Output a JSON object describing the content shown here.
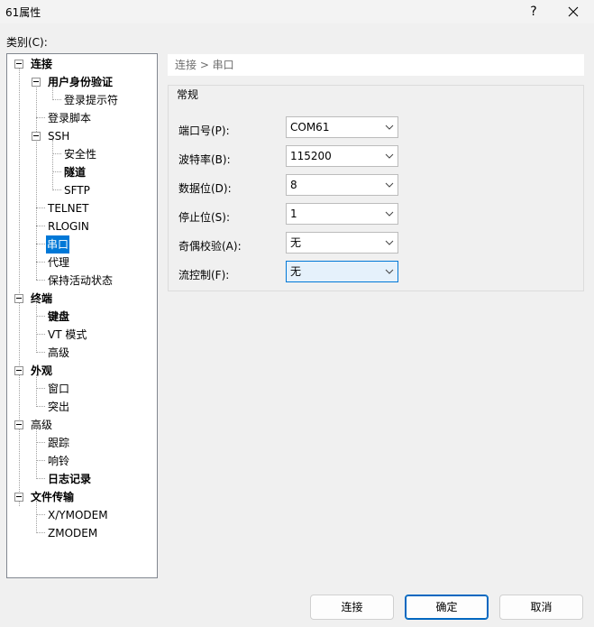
{
  "window": {
    "title": "61属性",
    "help_glyph": "?"
  },
  "category_label": "类别(C):",
  "tree": {
    "connection": "连接",
    "auth": "用户身份验证",
    "login_prompt": "登录提示符",
    "login_script": "登录脚本",
    "ssh": "SSH",
    "security": "安全性",
    "tunnel": "隧道",
    "sftp": "SFTP",
    "telnet": "TELNET",
    "rlogin": "RLOGIN",
    "serial": "串口",
    "proxy": "代理",
    "keepalive": "保持活动状态",
    "terminal": "终端",
    "keyboard": "键盘",
    "vt_mode": "VT 模式",
    "terminal_advanced": "高级",
    "appearance": "外观",
    "window": "窗口",
    "highlight": "突出",
    "advanced": "高级",
    "trace": "跟踪",
    "bell": "响铃",
    "logging": "日志记录",
    "file_transfer": "文件传输",
    "xymodem": "X/YMODEM",
    "zmodem": "ZMODEM"
  },
  "breadcrumb": "连接 > 串口",
  "group_title": "常规",
  "fields": {
    "port": {
      "label": "端口号(P):",
      "value": "COM61"
    },
    "baud": {
      "label": "波特率(B):",
      "value": "115200"
    },
    "data_bits": {
      "label": "数据位(D):",
      "value": "8"
    },
    "stop_bits": {
      "label": "停止位(S):",
      "value": "1"
    },
    "parity": {
      "label": "奇偶校验(A):",
      "value": "无"
    },
    "flow": {
      "label": "流控制(F):",
      "value": "无"
    }
  },
  "buttons": {
    "connect": "连接",
    "ok": "确定",
    "cancel": "取消"
  }
}
